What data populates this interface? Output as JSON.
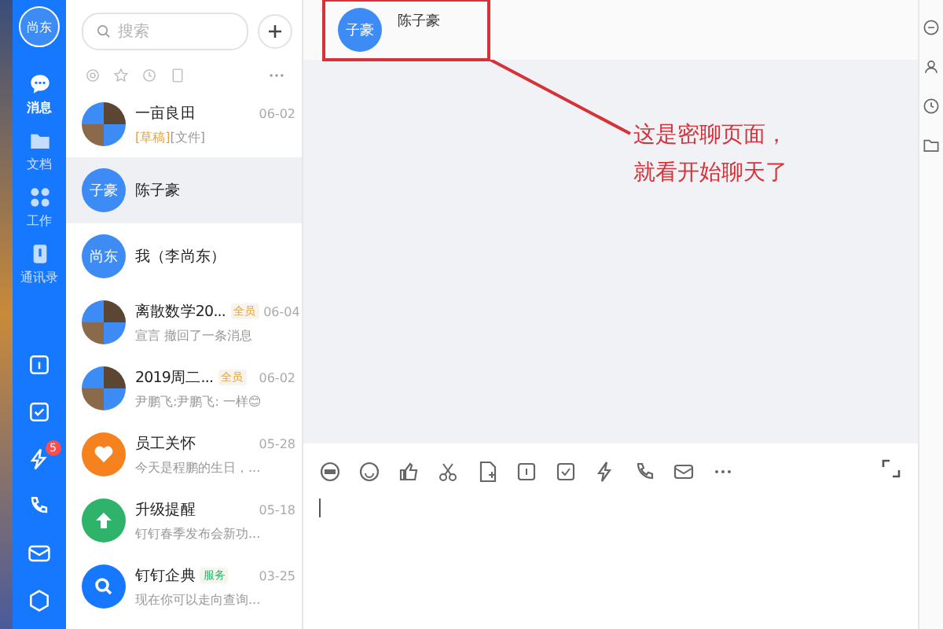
{
  "nav": {
    "avatar": "尚东",
    "items": [
      {
        "label": "消息",
        "selected": true
      },
      {
        "label": "文档",
        "selected": false
      },
      {
        "label": "工作",
        "selected": false
      },
      {
        "label": "通讯录",
        "selected": false
      }
    ],
    "tool_badge": "5"
  },
  "search": {
    "placeholder": "搜索"
  },
  "conversations": [
    {
      "kind": "group",
      "name": "一亩良田",
      "time": "06-02",
      "draft": "[草稿]",
      "preview": "[文件]",
      "selected": false
    },
    {
      "kind": "text",
      "avatar": "子豪",
      "name": "陈子豪",
      "selected": true
    },
    {
      "kind": "text",
      "avatar": "尚东",
      "name": "我（李尚东）",
      "selected": false
    },
    {
      "kind": "group",
      "name": "离散数学20...",
      "tag": {
        "label": "全员",
        "color": "#e8a23c"
      },
      "time": "06-04",
      "preview": "宣言 撤回了一条消息",
      "selected": false
    },
    {
      "kind": "group",
      "name": "2019周二...",
      "tag": {
        "label": "全员",
        "color": "#e8a23c"
      },
      "time": "06-02",
      "preview": "尹鹏飞:尹鹏飞: 一样😊",
      "selected": false
    },
    {
      "kind": "heart",
      "name": "员工关怀",
      "time": "05-28",
      "preview": "今天是程鹏的生日，...",
      "selected": false
    },
    {
      "kind": "upgrade",
      "name": "升级提醒",
      "time": "05-18",
      "preview": "钉钉春季发布会新功...",
      "selected": false
    },
    {
      "kind": "search",
      "name": "钉钉企典",
      "tag": {
        "label": "服务",
        "color": "#2fb36b"
      },
      "time": "03-25",
      "preview": "现在你可以走向查询...",
      "selected": false
    }
  ],
  "chat": {
    "avatar": "子豪",
    "name": "陈子豪",
    "annotation": [
      "这是密聊页面，",
      "就看开始聊天了"
    ]
  }
}
